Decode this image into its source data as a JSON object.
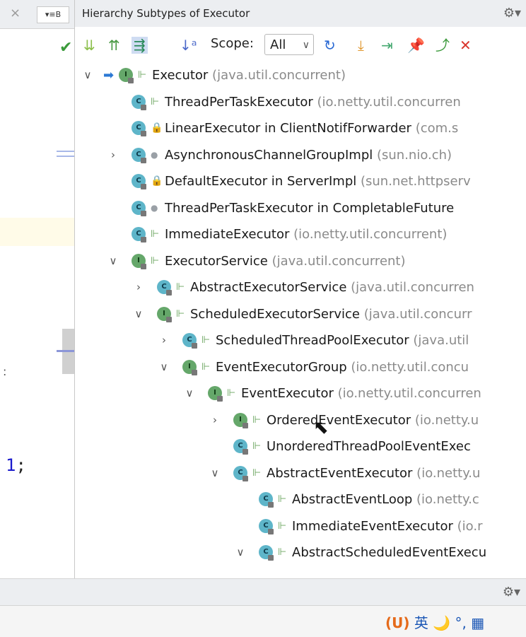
{
  "editor": {
    "close_glyph": "×",
    "tab_switch_label": "▾≡B",
    "check_glyph": "✔",
    "colon_glyph": ":",
    "code_number": "1",
    "code_suffix": ";"
  },
  "panel": {
    "title": "Hierarchy Subtypes of Executor",
    "gear_glyph": "⚙▾"
  },
  "toolbar": {
    "scope_label": "Scope:",
    "scope_value": "All",
    "icons": [
      {
        "name": "subtypes-icon",
        "glyph": "⇊",
        "color": "#8cbf4c"
      },
      {
        "name": "supertypes-icon",
        "glyph": "⇈",
        "color": "#4a9a44"
      },
      {
        "name": "class-hierarchy-icon",
        "glyph": "⇶",
        "color": "#2a8a5a"
      },
      {
        "name": "sort-alpha-icon",
        "glyph": "↓ᵃ",
        "color": "#4a68c9"
      },
      {
        "name": "refresh-icon",
        "glyph": "↻",
        "color": "#2b6ad4"
      },
      {
        "name": "expand-all-icon",
        "glyph": "⤓",
        "color": "#e0952a"
      },
      {
        "name": "collapse-all-icon",
        "glyph": "⇥",
        "color": "#45a870"
      },
      {
        "name": "pin-icon",
        "glyph": "📌",
        "color": "#6b7fbf"
      },
      {
        "name": "export-icon",
        "glyph": "⤴",
        "color": "#3c9a3c"
      },
      {
        "name": "close-icon",
        "glyph": "✕",
        "color": "#d9352c"
      }
    ]
  },
  "tree": [
    {
      "name": "Executor",
      "pkg": "(java.util.concurrent)",
      "kind": "interface",
      "vis": "public",
      "expanded": true
    },
    {
      "name": "ThreadPerTaskExecutor",
      "pkg": "(io.netty.util.concurren",
      "kind": "class",
      "vis": "public",
      "expanded": null
    },
    {
      "name": "LinearExecutor in ClientNotifForwarder",
      "pkg": "(com.s",
      "kind": "class",
      "vis": "private",
      "expanded": null
    },
    {
      "name": "AsynchronousChannelGroupImpl",
      "pkg": "(sun.nio.ch)",
      "kind": "class",
      "vis": "package",
      "expanded": false
    },
    {
      "name": "DefaultExecutor in ServerImpl",
      "pkg": "(sun.net.httpserv",
      "kind": "class",
      "vis": "private",
      "expanded": null
    },
    {
      "name": "ThreadPerTaskExecutor in CompletableFuture",
      "pkg": "",
      "kind": "class",
      "vis": "package",
      "expanded": null
    },
    {
      "name": "ImmediateExecutor",
      "pkg": "(io.netty.util.concurrent)",
      "kind": "class",
      "vis": "public",
      "expanded": null
    },
    {
      "name": "ExecutorService",
      "pkg": "(java.util.concurrent)",
      "kind": "interface",
      "vis": "public",
      "expanded": true
    },
    {
      "name": "AbstractExecutorService",
      "pkg": "(java.util.concurren",
      "kind": "class",
      "vis": "public",
      "expanded": false
    },
    {
      "name": "ScheduledExecutorService",
      "pkg": "(java.util.concurr",
      "kind": "interface",
      "vis": "public",
      "expanded": true
    },
    {
      "name": "ScheduledThreadPoolExecutor",
      "pkg": "(java.util",
      "kind": "class",
      "vis": "public",
      "expanded": false
    },
    {
      "name": "EventExecutorGroup",
      "pkg": "(io.netty.util.concu",
      "kind": "interface",
      "vis": "public",
      "expanded": true
    },
    {
      "name": "EventExecutor",
      "pkg": "(io.netty.util.concurren",
      "kind": "interface",
      "vis": "public",
      "expanded": true
    },
    {
      "name": "OrderedEventExecutor",
      "pkg": "(io.netty.u",
      "kind": "interface",
      "vis": "public",
      "expanded": false
    },
    {
      "name": "UnorderedThreadPoolEventExec",
      "pkg": "",
      "kind": "class",
      "vis": "public",
      "expanded": null
    },
    {
      "name": "AbstractEventExecutor",
      "pkg": "(io.netty.u",
      "kind": "class",
      "vis": "public",
      "expanded": true
    },
    {
      "name": "AbstractEventLoop",
      "pkg": "(io.netty.c",
      "kind": "class",
      "vis": "public",
      "expanded": null
    },
    {
      "name": "ImmediateEventExecutor",
      "pkg": "(io.r",
      "kind": "class",
      "vis": "public",
      "expanded": null
    },
    {
      "name": "AbstractScheduledEventExecu",
      "pkg": "",
      "kind": "class",
      "vis": "public",
      "expanded": true
    }
  ],
  "footer": {
    "gear_glyph": "⚙▾"
  },
  "status": {
    "ime_logo": "(U)",
    "ime_lang": "英",
    "ime_rest": "🌙 °, ▦"
  }
}
